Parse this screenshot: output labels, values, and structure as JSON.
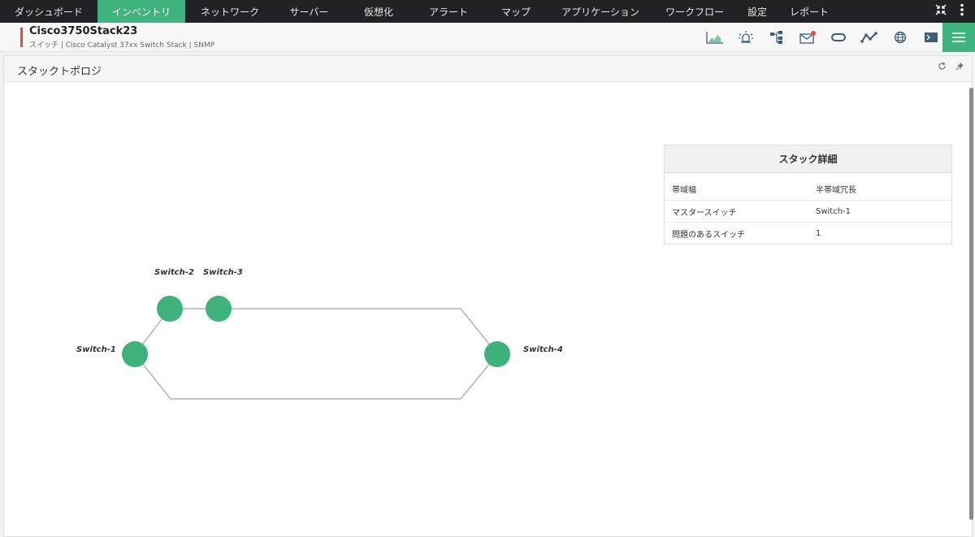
{
  "nav": {
    "items": [
      {
        "label": "ダッシュボード",
        "active": false
      },
      {
        "label": "インベントリ",
        "active": true
      },
      {
        "label": "ネットワーク",
        "active": false
      },
      {
        "label": "サーバー",
        "active": false
      },
      {
        "label": "仮想化",
        "active": false
      },
      {
        "label": "アラート",
        "active": false
      },
      {
        "label": "マップ",
        "active": false
      },
      {
        "label": "アプリケーション",
        "active": false
      },
      {
        "label": "ワークフロー",
        "active": false
      },
      {
        "label": "設定",
        "active": false
      },
      {
        "label": "レポート",
        "active": false
      }
    ],
    "right_icons": [
      "collapse-icon",
      "kebab-menu-icon"
    ]
  },
  "device": {
    "name": "Cisco3750Stack23",
    "subtitle": "スイッチ | Cisco Catalyst 37xx Switch Stack | SNMP",
    "icons": [
      "chart-icon",
      "alarm-icon",
      "network-icon",
      "mail-icon",
      "loop-icon",
      "graph-icon",
      "globe-icon",
      "terminal-icon"
    ],
    "accent": "#e84c3d"
  },
  "panel": {
    "title": "スタックトポロジ",
    "tools": [
      "refresh-icon",
      "pin-icon"
    ]
  },
  "stack_details": {
    "title": "スタック詳細",
    "rows": [
      {
        "key": "帯域幅",
        "value": "半帯域冗長"
      },
      {
        "key": "マスタースイッチ",
        "value": "Switch-1"
      },
      {
        "key": "問題のあるスイッチ",
        "value": "1"
      }
    ]
  },
  "topology": {
    "switches": [
      "Switch-1",
      "Switch-2",
      "Switch-3",
      "Switch-4"
    ],
    "node_color": "#3db37b"
  },
  "colors": {
    "accent_green": "#3fb37e",
    "nav_bg": "#202225"
  }
}
